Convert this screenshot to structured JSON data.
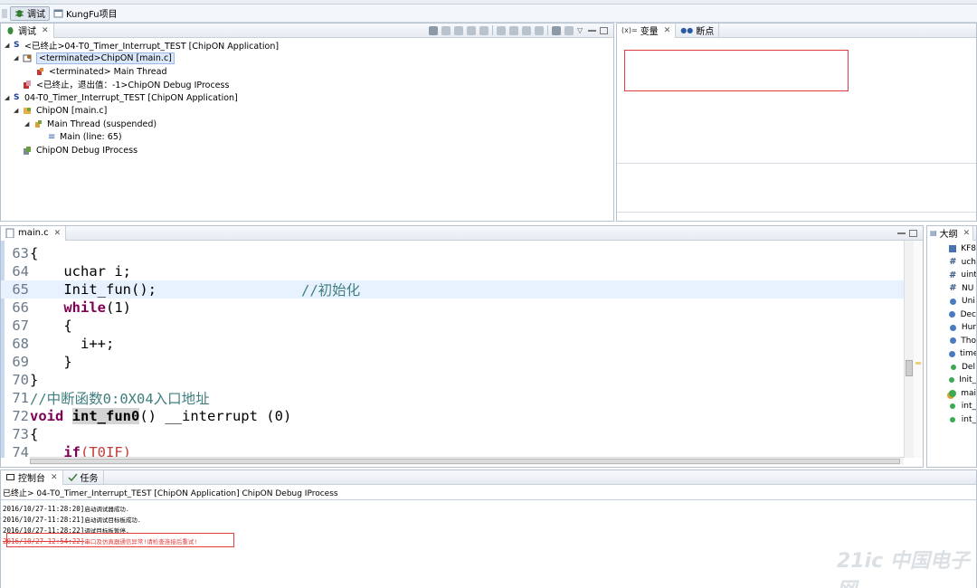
{
  "perspectives": {
    "debug_label": "调试",
    "project_label": "KungFu项目"
  },
  "debug_view": {
    "tab_label": "调试",
    "tree": [
      {
        "text": "<已终止>04-T0_Timer_Interrupt_TEST [ChipON Application]"
      },
      {
        "text": "<terminated>ChipON [main.c]"
      },
      {
        "text": "<terminated> Main Thread"
      },
      {
        "text": "<已终止，退出值：-1>ChipON Debug IProcess"
      },
      {
        "text": "04-T0_Timer_Interrupt_TEST [ChipON Application]"
      },
      {
        "text": "ChipON [main.c]"
      },
      {
        "text": "Main Thread (suspended)"
      },
      {
        "text": "Main (line: 65)"
      },
      {
        "text": "ChipON Debug IProcess"
      }
    ]
  },
  "variables_view": {
    "tab_variables": "变量",
    "tab_breakpoints": "断点"
  },
  "editor": {
    "tab_label": "main.c",
    "lines": [
      {
        "no": "63",
        "code": "{"
      },
      {
        "no": "64",
        "code": "    uchar i;"
      },
      {
        "no": "65",
        "code": "    Init_fun();",
        "comment": "//初始化"
      },
      {
        "no": "66",
        "keyword": "while",
        "rest": "(1)"
      },
      {
        "no": "67",
        "code": "    {"
      },
      {
        "no": "68",
        "code": "      i++;"
      },
      {
        "no": "69",
        "code": "    }"
      },
      {
        "no": "70",
        "code": "}"
      },
      {
        "no": "71",
        "comment_full": "//中断函数0:0X04入口地址"
      },
      {
        "no": "72",
        "keyword": "void",
        "fn": "int_fun0",
        "rest": "() __interrupt (0)"
      },
      {
        "no": "73",
        "code": "{"
      },
      {
        "no": "74",
        "keyword": "if",
        "rest": "(T0IF)"
      }
    ]
  },
  "outline_view": {
    "tab_label": "大纲",
    "items": [
      {
        "text": "KF8",
        "icon": "include-icon"
      },
      {
        "text": "uch",
        "icon": "hash-icon"
      },
      {
        "text": "uint",
        "icon": "hash-icon"
      },
      {
        "text": "NU",
        "icon": "hash-icon"
      },
      {
        "text": "Uni",
        "icon": "blue-dot-icon"
      },
      {
        "text": "Dec",
        "icon": "blue-dot-icon"
      },
      {
        "text": "Hur",
        "icon": "blue-dot-icon"
      },
      {
        "text": "Tho",
        "icon": "blue-dot-icon"
      },
      {
        "text": "time",
        "icon": "blue-dot-icon"
      },
      {
        "text": "Del",
        "icon": "green-dot-icon"
      },
      {
        "text": "Init_",
        "icon": "green-dot-icon"
      },
      {
        "text": "mai",
        "icon": "main-fn-icon"
      },
      {
        "text": "int_",
        "icon": "green-dot-icon"
      },
      {
        "text": "int_",
        "icon": "green-dot-icon"
      }
    ]
  },
  "console_view": {
    "tab_console": "控制台",
    "tab_tasks": "任务",
    "header": "已终止> 04-T0_Timer_Interrupt_TEST [ChipON Application] ChipON Debug IProcess",
    "lines": [
      {
        "ts": "2016/10/27-11:28:20]",
        "msg": "启动调试器成功.",
        "error": false
      },
      {
        "ts": "2016/10/27-11:28:21]",
        "msg": "启动调试目标板成功.",
        "error": false
      },
      {
        "ts": "2016/10/27-11:28:22]",
        "msg": "调试目标板暂停.",
        "error": false
      },
      {
        "ts": "2016/10/27-12:54:22]",
        "msg": "串口及仿真器通信异常!请检查连接后重试!",
        "error": true
      }
    ]
  },
  "watermark": "21ic 中国电子网",
  "colors": {
    "keyword": "#7f0055",
    "comment": "#3f7f7f",
    "error": "#e23c3c",
    "selection": "#dbe8fb"
  }
}
